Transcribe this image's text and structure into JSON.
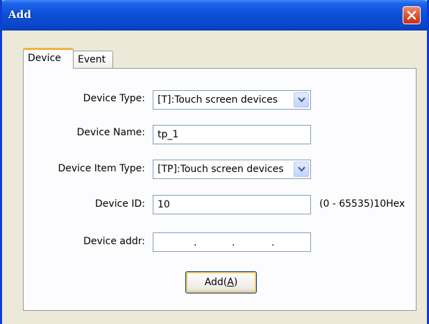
{
  "window": {
    "title": "Add",
    "close_icon": "close-icon"
  },
  "tabs": [
    {
      "label": "Device",
      "active": true
    },
    {
      "label": "Event",
      "active": false
    }
  ],
  "form": {
    "device_type": {
      "label": "Device Type:",
      "value": "[T]:Touch screen devices"
    },
    "device_name": {
      "label": "Device Name:",
      "value": "tp_1"
    },
    "device_item_type": {
      "label": "Device Item Type:",
      "value": "[TP]:Touch screen devices"
    },
    "device_id": {
      "label": "Device ID:",
      "value": "10",
      "hint": "(0 - 65535)10Hex"
    },
    "device_addr": {
      "label": "Device addr:",
      "separators": [
        ".",
        ".",
        "."
      ]
    }
  },
  "add_button": {
    "label_prefix": "Add(",
    "mnemonic": "A",
    "label_suffix": ")"
  },
  "colors": {
    "titlebar": "#0a48cc",
    "dialog_bg": "#ece9d8",
    "close_button": "#d9492a",
    "tab_highlight": "#f7b23a"
  }
}
